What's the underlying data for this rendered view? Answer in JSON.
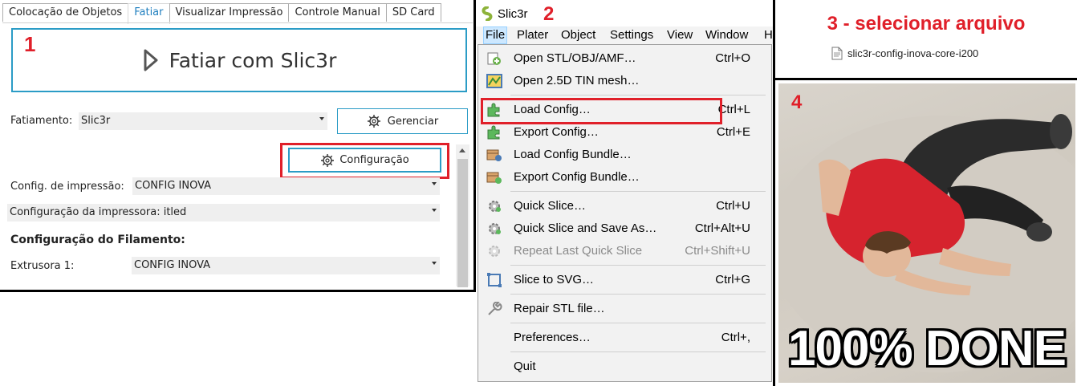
{
  "panel1": {
    "number": "1",
    "tabs": [
      "Colocação de Objetos",
      "Fatiar",
      "Visualizar Impressão",
      "Controle Manual",
      "SD Card"
    ],
    "active_tab": "Fatiar",
    "slice_button": "Fatiar com Slic3r",
    "slicer_label": "Fatiamento:",
    "slicer_value": "Slic3r",
    "manage_button": "Gerenciar",
    "config_button": "Configuração",
    "print_config_label": "Config. de impressão:",
    "print_config_value": "CONFIG INOVA",
    "printer_config_value": "Configuração da impressora: itled",
    "filament_heading": "Configuração do Filamento:",
    "extruder_label": "Extrusora 1:",
    "extruder_value": "CONFIG INOVA"
  },
  "panel2": {
    "number": "2",
    "title": "Slic3r",
    "menubar": [
      "File",
      "Plater",
      "Object",
      "Settings",
      "View",
      "Window",
      "H"
    ],
    "menu_items": [
      {
        "label": "Open STL/OBJ/AMF…",
        "shortcut": "Ctrl+O",
        "icon": "open-file-icon"
      },
      {
        "label": "Open 2.5D TIN mesh…",
        "shortcut": "",
        "icon": "tin-mesh-icon"
      },
      {
        "label": "Load Config…",
        "shortcut": "Ctrl+L",
        "icon": "plugin-icon"
      },
      {
        "label": "Export Config…",
        "shortcut": "Ctrl+E",
        "icon": "plugin-icon"
      },
      {
        "label": "Load Config Bundle…",
        "shortcut": "",
        "icon": "bundle-load-icon"
      },
      {
        "label": "Export Config Bundle…",
        "shortcut": "",
        "icon": "bundle-export-icon"
      },
      {
        "label": "Quick Slice…",
        "shortcut": "Ctrl+U",
        "icon": "cog-icon"
      },
      {
        "label": "Quick Slice and Save As…",
        "shortcut": "Ctrl+Alt+U",
        "icon": "cog-icon"
      },
      {
        "label": "Repeat Last Quick Slice",
        "shortcut": "Ctrl+Shift+U",
        "icon": "cog-icon"
      },
      {
        "label": "Slice to SVG…",
        "shortcut": "Ctrl+G",
        "icon": "svg-icon"
      },
      {
        "label": "Repair STL file…",
        "shortcut": "",
        "icon": "wrench-icon"
      },
      {
        "label": "Preferences…",
        "shortcut": "Ctrl+,",
        "icon": ""
      },
      {
        "label": "Quit",
        "shortcut": "",
        "icon": ""
      }
    ]
  },
  "panel3": {
    "heading": "3 - selecionar arquivo",
    "file_name": "slic3r-config-inova-core-i200"
  },
  "panel4": {
    "number": "4",
    "caption": "100% DONE"
  },
  "colors": {
    "accent_blue": "#2b9cc6",
    "highlight_red": "#e0202a",
    "shirt_red": "#d6232e"
  }
}
